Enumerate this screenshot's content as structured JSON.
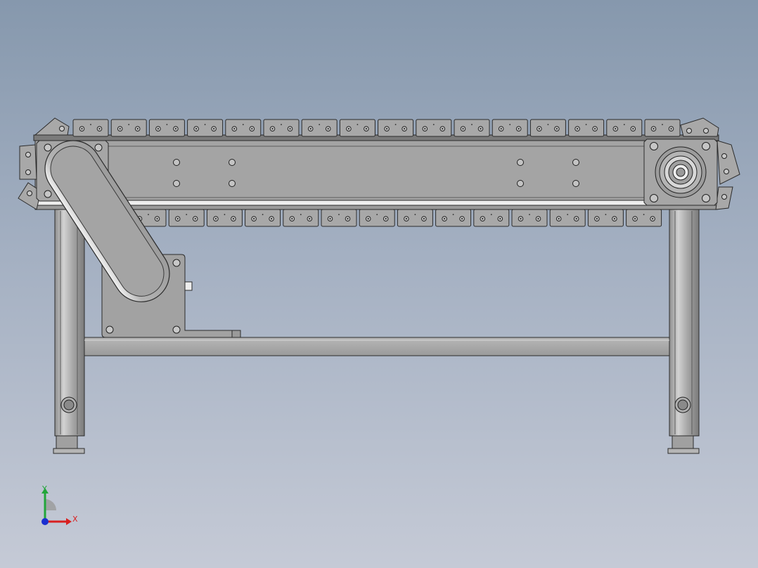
{
  "viewport": {
    "background_top": "#8698ad",
    "background_bottom": "#c5cad6"
  },
  "model": {
    "part_fill": "#a6a6a6",
    "part_edge": "#2b2b2b",
    "highlight": "#e8e8e8"
  },
  "triad": {
    "y_label": "Y",
    "x_label": "X",
    "y_color": "#22a63a",
    "x_color": "#d82020",
    "z_color": "#1b2fd0"
  }
}
